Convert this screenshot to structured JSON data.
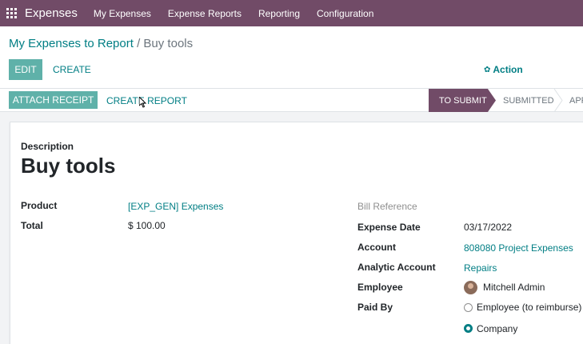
{
  "navbar": {
    "brand": "Expenses",
    "items": [
      "My Expenses",
      "Expense Reports",
      "Reporting",
      "Configuration"
    ]
  },
  "breadcrumb": {
    "parent": "My Expenses to Report",
    "separator": "/",
    "current": "Buy tools"
  },
  "toolbar": {
    "edit_label": "EDIT",
    "create_label": "CREATE",
    "action_label": "Action"
  },
  "statusbar": {
    "attach_label": "ATTACH RECEIPT",
    "create_report_label": "CREATE REPORT",
    "stages": [
      "TO SUBMIT",
      "SUBMITTED",
      "APP"
    ],
    "active_stage": "TO SUBMIT"
  },
  "form": {
    "description_label": "Description",
    "title": "Buy tools",
    "product_label": "Product",
    "product_value": "[EXP_GEN] Expenses",
    "total_label": "Total",
    "total_value": "$ 100.00",
    "bill_reference_label": "Bill Reference",
    "expense_date_label": "Expense Date",
    "expense_date_value": "03/17/2022",
    "account_label": "Account",
    "account_value": "808080 Project Expenses",
    "analytic_account_label": "Analytic Account",
    "analytic_account_value": "Repairs",
    "employee_label": "Employee",
    "employee_value": "Mitchell Admin",
    "paid_by_label": "Paid By",
    "paid_by_options": [
      "Employee (to reimburse)",
      "Company"
    ],
    "paid_by_selected": "Company"
  },
  "colors": {
    "brand": "#714b67",
    "accent": "#017e84",
    "button": "#5fb1a9"
  }
}
